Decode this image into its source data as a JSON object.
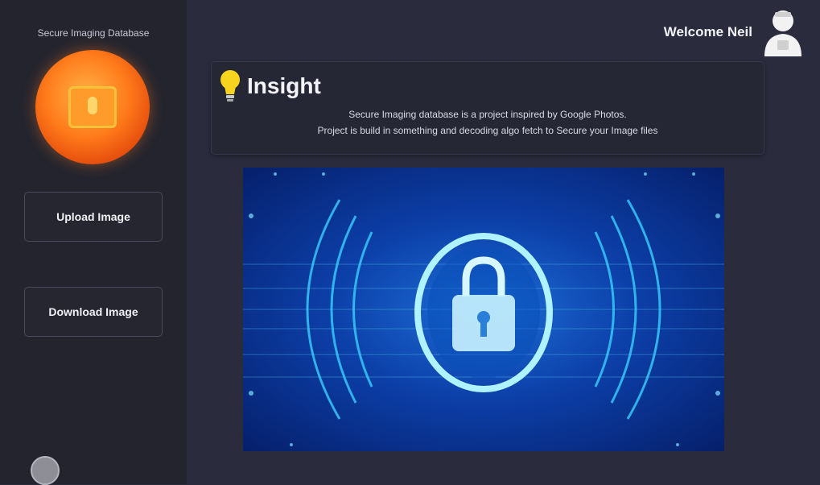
{
  "sidebar": {
    "app_title": "Secure Imaging Database",
    "upload_label": "Upload Image",
    "download_label": "Download Image"
  },
  "header": {
    "welcome_text": "Welcome Neil"
  },
  "insight": {
    "title": "Insight",
    "line1": "Secure Imaging database is a project inspired by Google Photos.",
    "line2": "Project is build in something and decoding algo fetch to Secure your Image files"
  },
  "icons": {
    "logo": "lock-folder-icon",
    "user": "user-icon",
    "bulb": "lightbulb-icon",
    "settings": "settings-icon",
    "hero": "cyber-security-lock-image"
  },
  "colors": {
    "background": "#2a2b3d",
    "sidebar": "#23242e",
    "accent_orange": "#ff7a1a",
    "hero_blue": "#0c3fa8"
  }
}
